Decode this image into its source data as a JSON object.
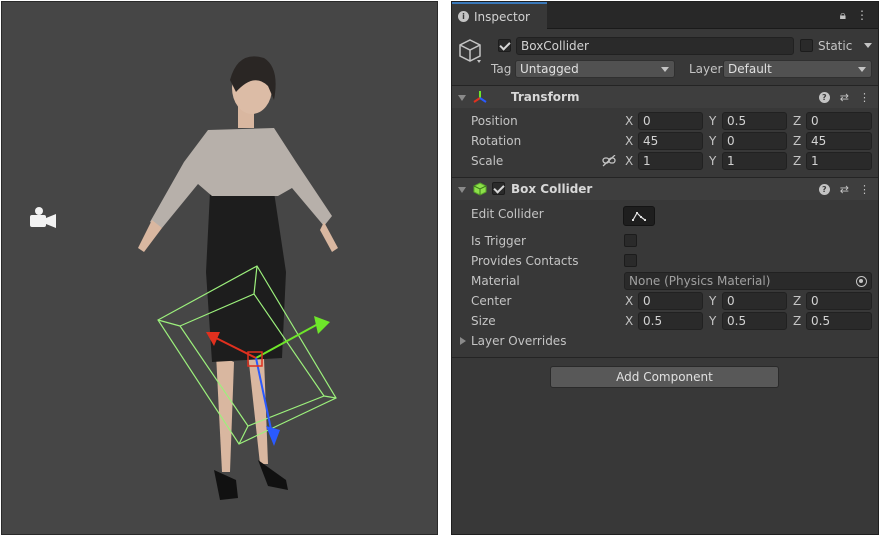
{
  "inspector": {
    "tab_label": "Inspector",
    "object": {
      "name": "BoxCollider",
      "active": true,
      "static_label": "Static",
      "static": false,
      "tag_label": "Tag",
      "tag_value": "Untagged",
      "layer_label": "Layer",
      "layer_value": "Default"
    },
    "transform": {
      "title": "Transform",
      "position_label": "Position",
      "rotation_label": "Rotation",
      "scale_label": "Scale",
      "position": {
        "x": "0",
        "y": "0.5",
        "z": "0"
      },
      "rotation": {
        "x": "45",
        "y": "0",
        "z": "45"
      },
      "scale": {
        "x": "1",
        "y": "1",
        "z": "1"
      }
    },
    "box_collider": {
      "title": "Box Collider",
      "enabled": true,
      "edit_collider_label": "Edit Collider",
      "is_trigger_label": "Is Trigger",
      "provides_contacts_label": "Provides Contacts",
      "material_label": "Material",
      "material_value": "None (Physics Material)",
      "center_label": "Center",
      "size_label": "Size",
      "center": {
        "x": "0",
        "y": "0",
        "z": "0"
      },
      "size": {
        "x": "0.5",
        "y": "0.5",
        "z": "0.5"
      },
      "layer_overrides_label": "Layer Overrides"
    },
    "axis_labels": {
      "x": "X",
      "y": "Y",
      "z": "Z"
    },
    "add_component_label": "Add Component"
  },
  "colors": {
    "scene_bg": "#464646",
    "inspector_bg": "#383838",
    "accent_tab": "#3a79bb",
    "gizmo_x": "#e0301e",
    "gizmo_y": "#6ee62a",
    "gizmo_z": "#2a5aff",
    "collider_wire": "#9cf07c"
  },
  "icons": [
    "camera-icon",
    "lock-icon",
    "kebab-menu-icon",
    "gameobject-cube-icon",
    "transform-axes-icon",
    "box-collider-icon",
    "help-icon",
    "preset-sliders-icon",
    "edit-collider-icon",
    "object-picker-icon",
    "constrain-proportions-icon"
  ]
}
